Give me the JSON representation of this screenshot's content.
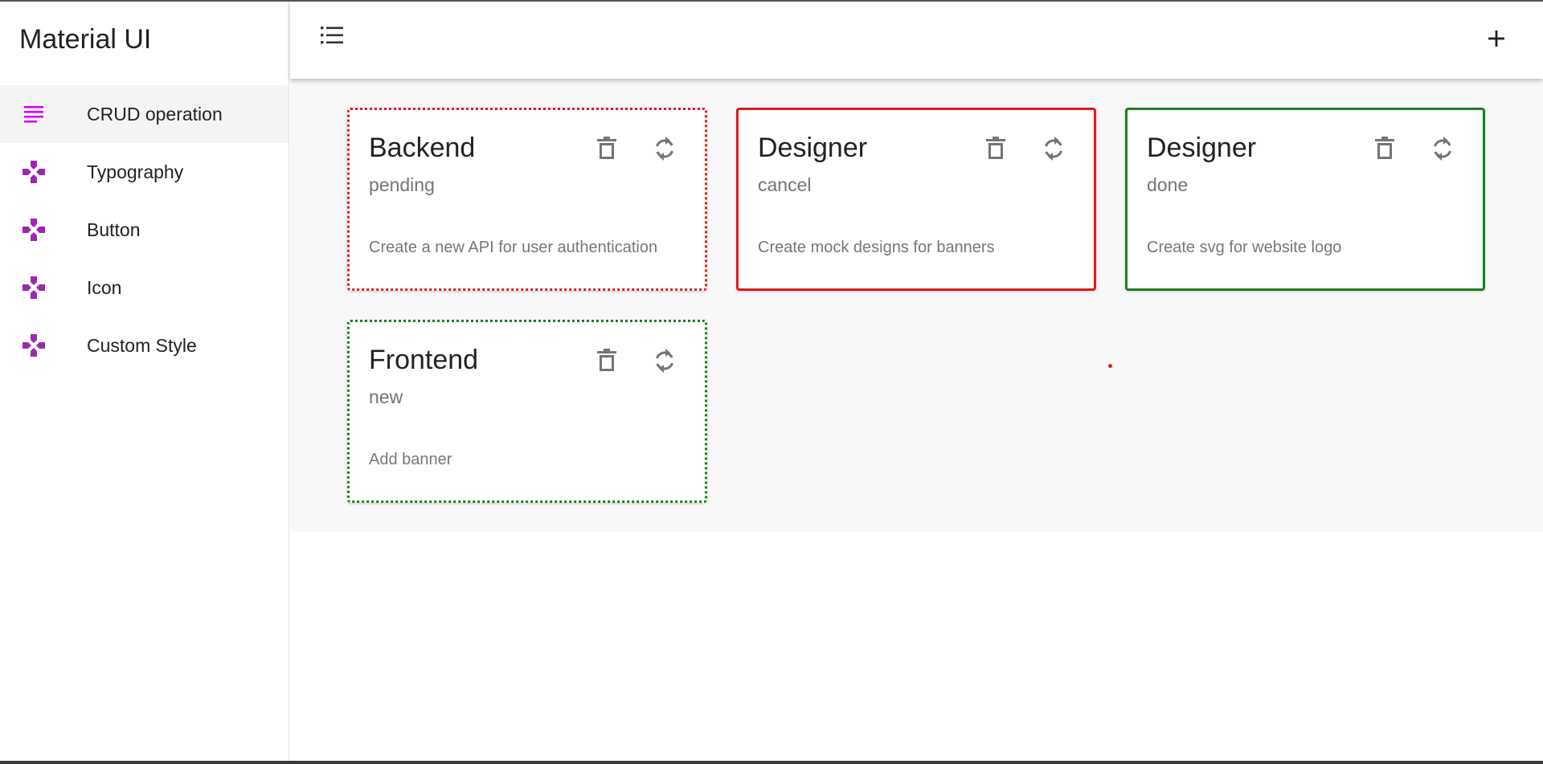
{
  "brand": {
    "title": "Material UI"
  },
  "sidebar": {
    "items": [
      {
        "label": "CRUD operation",
        "icon": "notes-icon",
        "active": true
      },
      {
        "label": "Typography",
        "icon": "gamepad-icon",
        "active": false
      },
      {
        "label": "Button",
        "icon": "gamepad-icon",
        "active": false
      },
      {
        "label": "Icon",
        "icon": "gamepad-icon",
        "active": false
      },
      {
        "label": "Custom Style",
        "icon": "gamepad-icon",
        "active": false
      }
    ]
  },
  "appbar": {
    "menu_icon": "list-icon",
    "add_icon": "plus-icon"
  },
  "cards": [
    {
      "title": "Backend",
      "status": "pending",
      "description": "Create a new API for user authentication",
      "border": "dotted",
      "color": "#e01b1b"
    },
    {
      "title": "Designer",
      "status": "cancel",
      "description": "Create mock designs for banners",
      "border": "solid",
      "color": "#e01b1b"
    },
    {
      "title": "Designer",
      "status": "done",
      "description": "Create svg for website logo",
      "border": "solid",
      "color": "#1e7d1e"
    },
    {
      "title": "Frontend",
      "status": "new",
      "description": "Add banner",
      "border": "dotted",
      "color": "#1e7d1e"
    }
  ],
  "colors": {
    "accent_purple": "#9c27b0",
    "active_icon": "#d500f9",
    "red": "#e01b1b",
    "green": "#1e7d1e",
    "icon_grey": "#757575"
  }
}
